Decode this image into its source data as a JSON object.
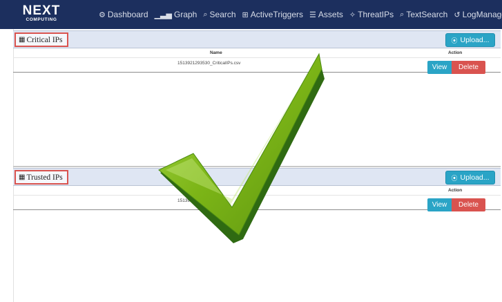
{
  "app": {
    "logo_main": "NEXT",
    "logo_sub": "COMPUTING"
  },
  "nav": {
    "items": [
      {
        "icon": "dashboard-icon",
        "glyph": "⚙",
        "label": "Dashboard"
      },
      {
        "icon": "graph-icon",
        "glyph": "▁▃▅",
        "label": "Graph"
      },
      {
        "icon": "search-icon",
        "glyph": "⌕",
        "label": "Search"
      },
      {
        "icon": "triggers-icon",
        "glyph": "⊞",
        "label": "ActiveTriggers"
      },
      {
        "icon": "list-icon",
        "glyph": "☰",
        "label": "Assets"
      },
      {
        "icon": "threat-icon",
        "glyph": "✧",
        "label": "ThreatIPs"
      },
      {
        "icon": "text-search-icon",
        "glyph": "⌕",
        "label": "TextSearch"
      },
      {
        "icon": "history-icon",
        "glyph": "↺",
        "label": "LogManager"
      }
    ]
  },
  "critical": {
    "title": "Critical IPs",
    "upload_label": "Upload...",
    "col_name": "Name",
    "col_action": "Action",
    "file_name": "1513921293530_CriticalIPs.csv",
    "view_label": "View",
    "delete_label": "Delete"
  },
  "trusted": {
    "title": "Trusted IPs",
    "upload_label": "Upload...",
    "col_action": "Action",
    "file_name_partial": "151392",
    "view_label": "View",
    "delete_label": "Delete"
  },
  "colors": {
    "navbar": "#1c2f5e",
    "upload": "#2aa4c6",
    "view": "#2aa4c6",
    "delete": "#d9534f",
    "check_green": "#7fb814"
  }
}
